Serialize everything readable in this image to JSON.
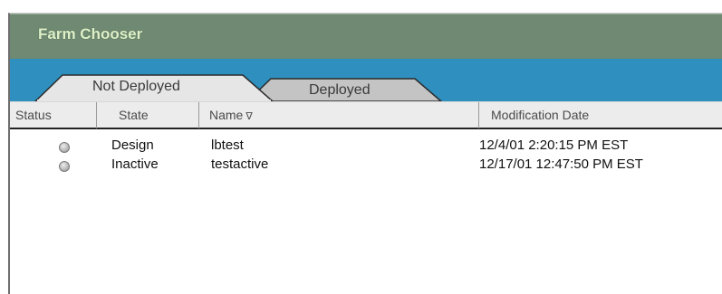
{
  "window": {
    "title": "Farm Chooser"
  },
  "tabs": [
    {
      "label": "Not Deployed",
      "active": true
    },
    {
      "label": "Deployed",
      "active": false
    }
  ],
  "columns": [
    {
      "label": "Status"
    },
    {
      "label": "State"
    },
    {
      "label": "Name",
      "sort_indicator": "∇"
    },
    {
      "label": "Modification Date"
    }
  ],
  "rows": [
    {
      "status": "inactive-dot",
      "state": "Design",
      "name": "lbtest",
      "modified": "12/4/01 2:20:15 PM EST"
    },
    {
      "status": "inactive-dot",
      "state": "Inactive",
      "name": "testactive",
      "modified": "12/17/01 12:47:50 PM EST"
    }
  ],
  "colors": {
    "titlebar": "#6f8972",
    "title_text": "#dff0c8",
    "tabbar": "#2f8fbe",
    "active_tab": "#e6e6e6",
    "inactive_tab": "#c4c4c4"
  }
}
